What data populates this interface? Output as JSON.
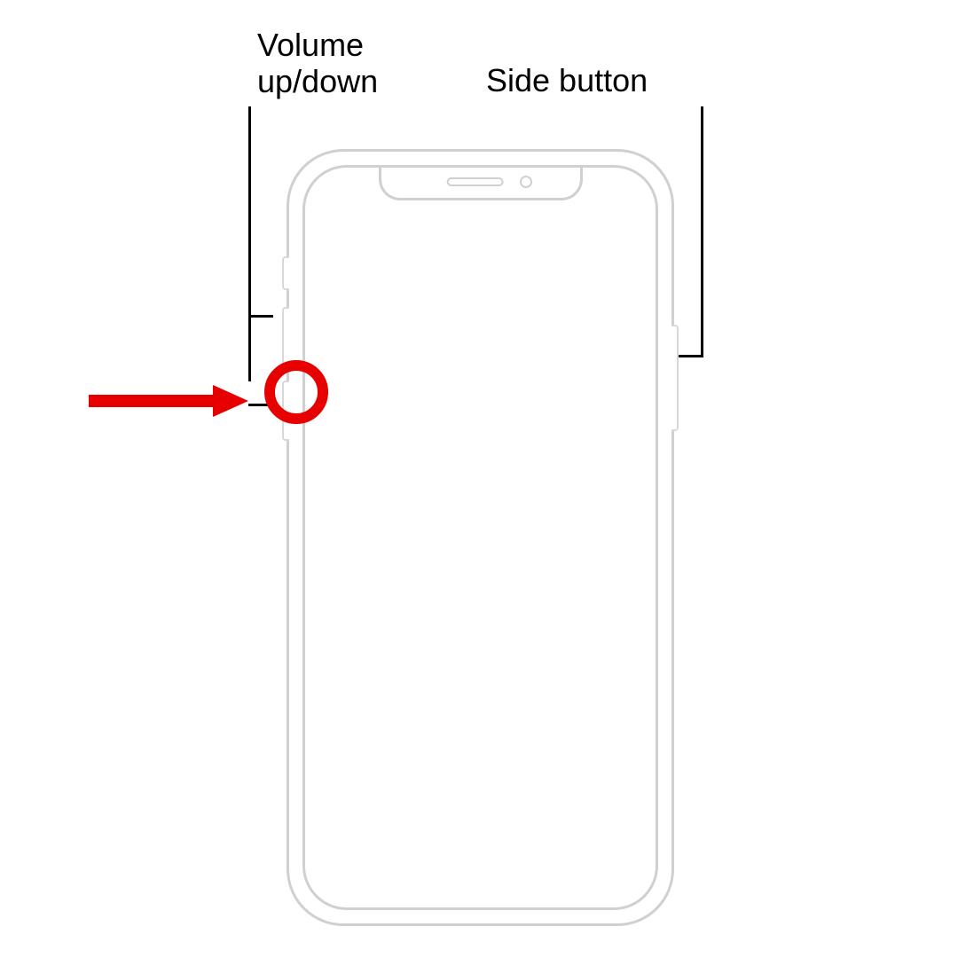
{
  "labels": {
    "volume": "Volume up/down",
    "side": "Side button"
  },
  "colors": {
    "outline": "#d0d0d0",
    "highlight": "#e60000",
    "text": "#000000"
  },
  "diagram": {
    "device": "iPhone (Face ID model)",
    "highlighted_control": "volume-down-button"
  }
}
